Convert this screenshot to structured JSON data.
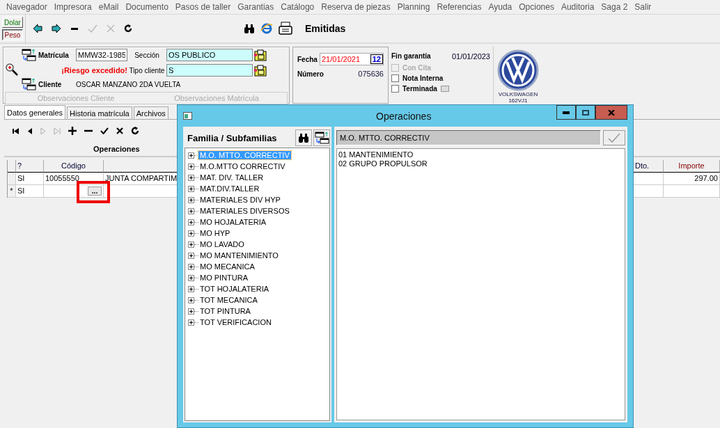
{
  "menu": [
    {
      "label": "Navegador"
    },
    {
      "label": "Impresora"
    },
    {
      "label": "eMail"
    },
    {
      "label": "Documento"
    },
    {
      "label": "Pasos de taller"
    },
    {
      "label": "Garantias"
    },
    {
      "label": "Catálogo"
    },
    {
      "label": "Reserva de piezas"
    },
    {
      "label": "Planning"
    },
    {
      "label": "Referencias"
    },
    {
      "label": "Ayuda"
    },
    {
      "label": "Opciones"
    },
    {
      "label": "Auditoria"
    },
    {
      "label": "Saga 2"
    },
    {
      "label": "Salir"
    }
  ],
  "currency": [
    {
      "label": "Dolar",
      "selected": false
    },
    {
      "label": "Peso",
      "selected": true
    }
  ],
  "toolbar": {
    "title": "Emitidas"
  },
  "vehicle": {
    "matricula_label": "Matrícula",
    "matricula": "MMW32-1985",
    "seccion_label": "Sección",
    "seccion": "OS PUBLICO",
    "risk": "¡Riesgo excedido!",
    "tipo_label": "Tipo cliente",
    "tipo": "S",
    "cliente_label": "Cliente",
    "cliente": "OSCAR MANZANO 2DA VUELTA",
    "observations": [
      "Observaciones  Cliente",
      "Observaciones  Matrícula"
    ]
  },
  "document": {
    "fecha_label": "Fecha",
    "fecha": "21/01/2021",
    "calendar": "12",
    "numero_label": "Número",
    "numero": "075636"
  },
  "warranty": {
    "label": "Fin garantía",
    "date": "01/01/2023",
    "checks": [
      {
        "label": "Con Cita",
        "checked": false,
        "disabled": true
      },
      {
        "label": "Nota Interna",
        "checked": false,
        "disabled": false
      },
      {
        "label": "Terminada",
        "checked": false,
        "disabled": false
      }
    ]
  },
  "brand": {
    "name": "VOLKSWAGEN",
    "code": "162VJ1"
  },
  "tabs": [
    {
      "label": "Datos generales",
      "selected": true
    },
    {
      "label": "Historia matrícula",
      "selected": false
    },
    {
      "label": "Archivos",
      "selected": false
    }
  ],
  "section_title": "Operaciones",
  "grid": {
    "columns": [
      "?",
      "Código",
      "Dto.",
      "Importe"
    ],
    "rows": [
      {
        "marker": "",
        "flag": "SI",
        "code": "10055550",
        "description": "JUNTA COMPARTIM",
        "importe": "297.00"
      },
      {
        "marker": "*",
        "flag": "SI",
        "code": "",
        "button": "..."
      }
    ]
  },
  "dialog": {
    "title": "Operaciones",
    "tree_title": "Familia / Subfamilias",
    "filter": "M.O. MTTO. CORRECTIV",
    "tree": [
      {
        "label": "M.O. MTTO. CORRECTIV",
        "selected": true,
        "expanded": false
      },
      {
        "label": "M.O.MTTO CORRECTIV",
        "selected": false,
        "expanded": false
      },
      {
        "label": "MAT. DIV. TALLER",
        "selected": false,
        "expanded": false
      },
      {
        "label": "MAT.DIV.TALLER",
        "selected": false,
        "expanded": false
      },
      {
        "label": "MATERIALES DIV HYP",
        "selected": false,
        "expanded": false
      },
      {
        "label": "MATERIALES DIVERSOS",
        "selected": false,
        "expanded": false
      },
      {
        "label": "MO HOJALATERIA",
        "selected": false,
        "expanded": false
      },
      {
        "label": "MO HYP",
        "selected": false,
        "expanded": false
      },
      {
        "label": "MO LAVADO",
        "selected": false,
        "expanded": false
      },
      {
        "label": "MO MANTENIMIENTO",
        "selected": false,
        "expanded": false
      },
      {
        "label": "MO MECANICA",
        "selected": false,
        "expanded": false
      },
      {
        "label": "MO PINTURA",
        "selected": false,
        "expanded": false
      },
      {
        "label": "TOT HOJALATERIA",
        "selected": false,
        "expanded": false
      },
      {
        "label": "TOT MECANICA",
        "selected": false,
        "expanded": false
      },
      {
        "label": "TOT PINTURA",
        "selected": false,
        "expanded": false
      },
      {
        "label": "TOT VERIFICACION",
        "selected": false,
        "expanded": false
      }
    ],
    "items": [
      {
        "label": "01 MANTENIMIENTO"
      },
      {
        "label": "02 GRUPO PROPULSOR"
      }
    ]
  }
}
